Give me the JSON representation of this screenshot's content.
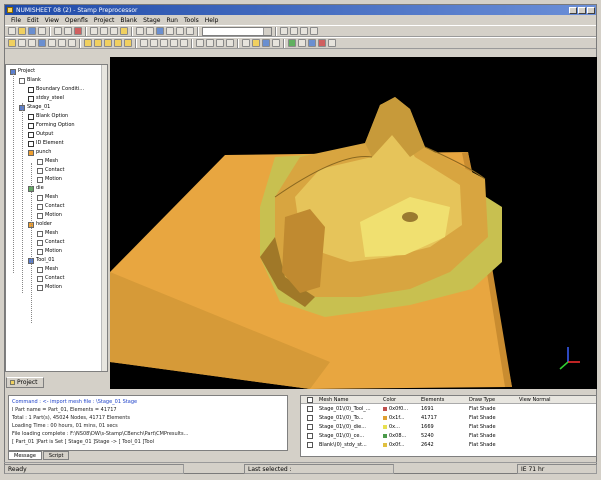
{
  "window": {
    "title": "NUMISHEET 08 (2) - Stamp Preprocessor",
    "buttons": [
      "min",
      "max",
      "close"
    ]
  },
  "menu": [
    "File",
    "Edit",
    "View",
    "Openfls",
    "Project",
    "Blank",
    "Stage",
    "Run",
    "Tools",
    "Help"
  ],
  "tree": {
    "items": [
      {
        "label": "Project",
        "indent": 0,
        "icon": "blu"
      },
      {
        "label": "Blank",
        "indent": 1,
        "icon": "mesh"
      },
      {
        "label": "Boundary Conditi...",
        "indent": 2,
        "icon": "chk"
      },
      {
        "label": "stdsy_steel",
        "indent": 2,
        "icon": "chk"
      },
      {
        "label": "Stage_01",
        "indent": 1,
        "icon": "blu"
      },
      {
        "label": "Blank Option",
        "indent": 2,
        "icon": "chk"
      },
      {
        "label": "Forming Option",
        "indent": 2,
        "icon": "chk"
      },
      {
        "label": "Output",
        "indent": 2,
        "icon": "chk"
      },
      {
        "label": "ID Element",
        "indent": 2,
        "icon": "chk"
      },
      {
        "label": "punch",
        "indent": 2,
        "icon": "org"
      },
      {
        "label": "Mesh",
        "indent": 3,
        "icon": "mesh"
      },
      {
        "label": "Contact",
        "indent": 3,
        "icon": "mesh"
      },
      {
        "label": "Motion",
        "indent": 3,
        "icon": "mesh"
      },
      {
        "label": "die",
        "indent": 2,
        "icon": "grn"
      },
      {
        "label": "Mesh",
        "indent": 3,
        "icon": "mesh"
      },
      {
        "label": "Contact",
        "indent": 3,
        "icon": "mesh"
      },
      {
        "label": "Motion",
        "indent": 3,
        "icon": "mesh"
      },
      {
        "label": "holder",
        "indent": 2,
        "icon": "org"
      },
      {
        "label": "Mesh",
        "indent": 3,
        "icon": "mesh"
      },
      {
        "label": "Contact",
        "indent": 3,
        "icon": "mesh"
      },
      {
        "label": "Motion",
        "indent": 3,
        "icon": "mesh"
      },
      {
        "label": "Tool_01",
        "indent": 2,
        "icon": "blu"
      },
      {
        "label": "Mesh",
        "indent": 3,
        "icon": "mesh"
      },
      {
        "label": "Contact",
        "indent": 3,
        "icon": "mesh"
      },
      {
        "label": "Motion",
        "indent": 3,
        "icon": "mesh"
      }
    ]
  },
  "project_tab": "Project",
  "messages": [
    {
      "text": "Command : <- import mesh file : \\Stage_01 Stage",
      "blue": true
    },
    {
      "text": "  I Part name = Part_01, Elements = 41717",
      "blue": false
    },
    {
      "text": "  Total : 1 Part(s), 45024 Nodes, 41717 Elements",
      "blue": false
    },
    {
      "text": "  Loading Time : 00 hours, 01 mins, 01 secs",
      "blue": false
    },
    {
      "text": "  File loading complete : F:\\NS08\\DW\\s-Stamp\\CBench\\Part\\CMPresults...",
      "blue": false
    },
    {
      "text": "  [ Part_01 ]Part is Set [ Stage_01 ]Stage -> [ Tool_01 ]Tool",
      "blue": false
    }
  ],
  "message_tabs": [
    "Message",
    "Script"
  ],
  "mesh_table": {
    "headers": [
      "Mesh Name",
      "Color",
      "Elements",
      "Draw Type",
      "View Normal"
    ],
    "rows": [
      {
        "name": "Stage_01\\(0)_Tool_...",
        "color_label": "0x0f0...",
        "color": "#c0504d",
        "elements": "1691",
        "draw": "Flat Shade",
        "normal": ""
      },
      {
        "name": "Stage_01\\(0)_To...",
        "color_label": "0x1f...",
        "color": "#e0a030",
        "elements": "41717",
        "draw": "Flat Shade",
        "normal": ""
      },
      {
        "name": "Stage_01\\(0)_die...",
        "color_label": "0x...",
        "color": "#e8e050",
        "elements": "1669",
        "draw": "Flat Shade",
        "normal": ""
      },
      {
        "name": "Stage_01\\(0)_ce...",
        "color_label": "0x08...",
        "color": "#4a9a4a",
        "elements": "5240",
        "draw": "Flat Shade",
        "normal": ""
      },
      {
        "name": "Blank\\(0)_stdy_st...",
        "color_label": "0x0f...",
        "color": "#e0c040",
        "elements": "2642",
        "draw": "Flat Shade",
        "normal": ""
      }
    ]
  },
  "status": {
    "left": "Ready",
    "mid": "Last selected :",
    "right": "IE 71 hr"
  },
  "colors": {
    "viewport_bg": "#000000",
    "blank": "#e8a640",
    "die": "#c8c050"
  }
}
